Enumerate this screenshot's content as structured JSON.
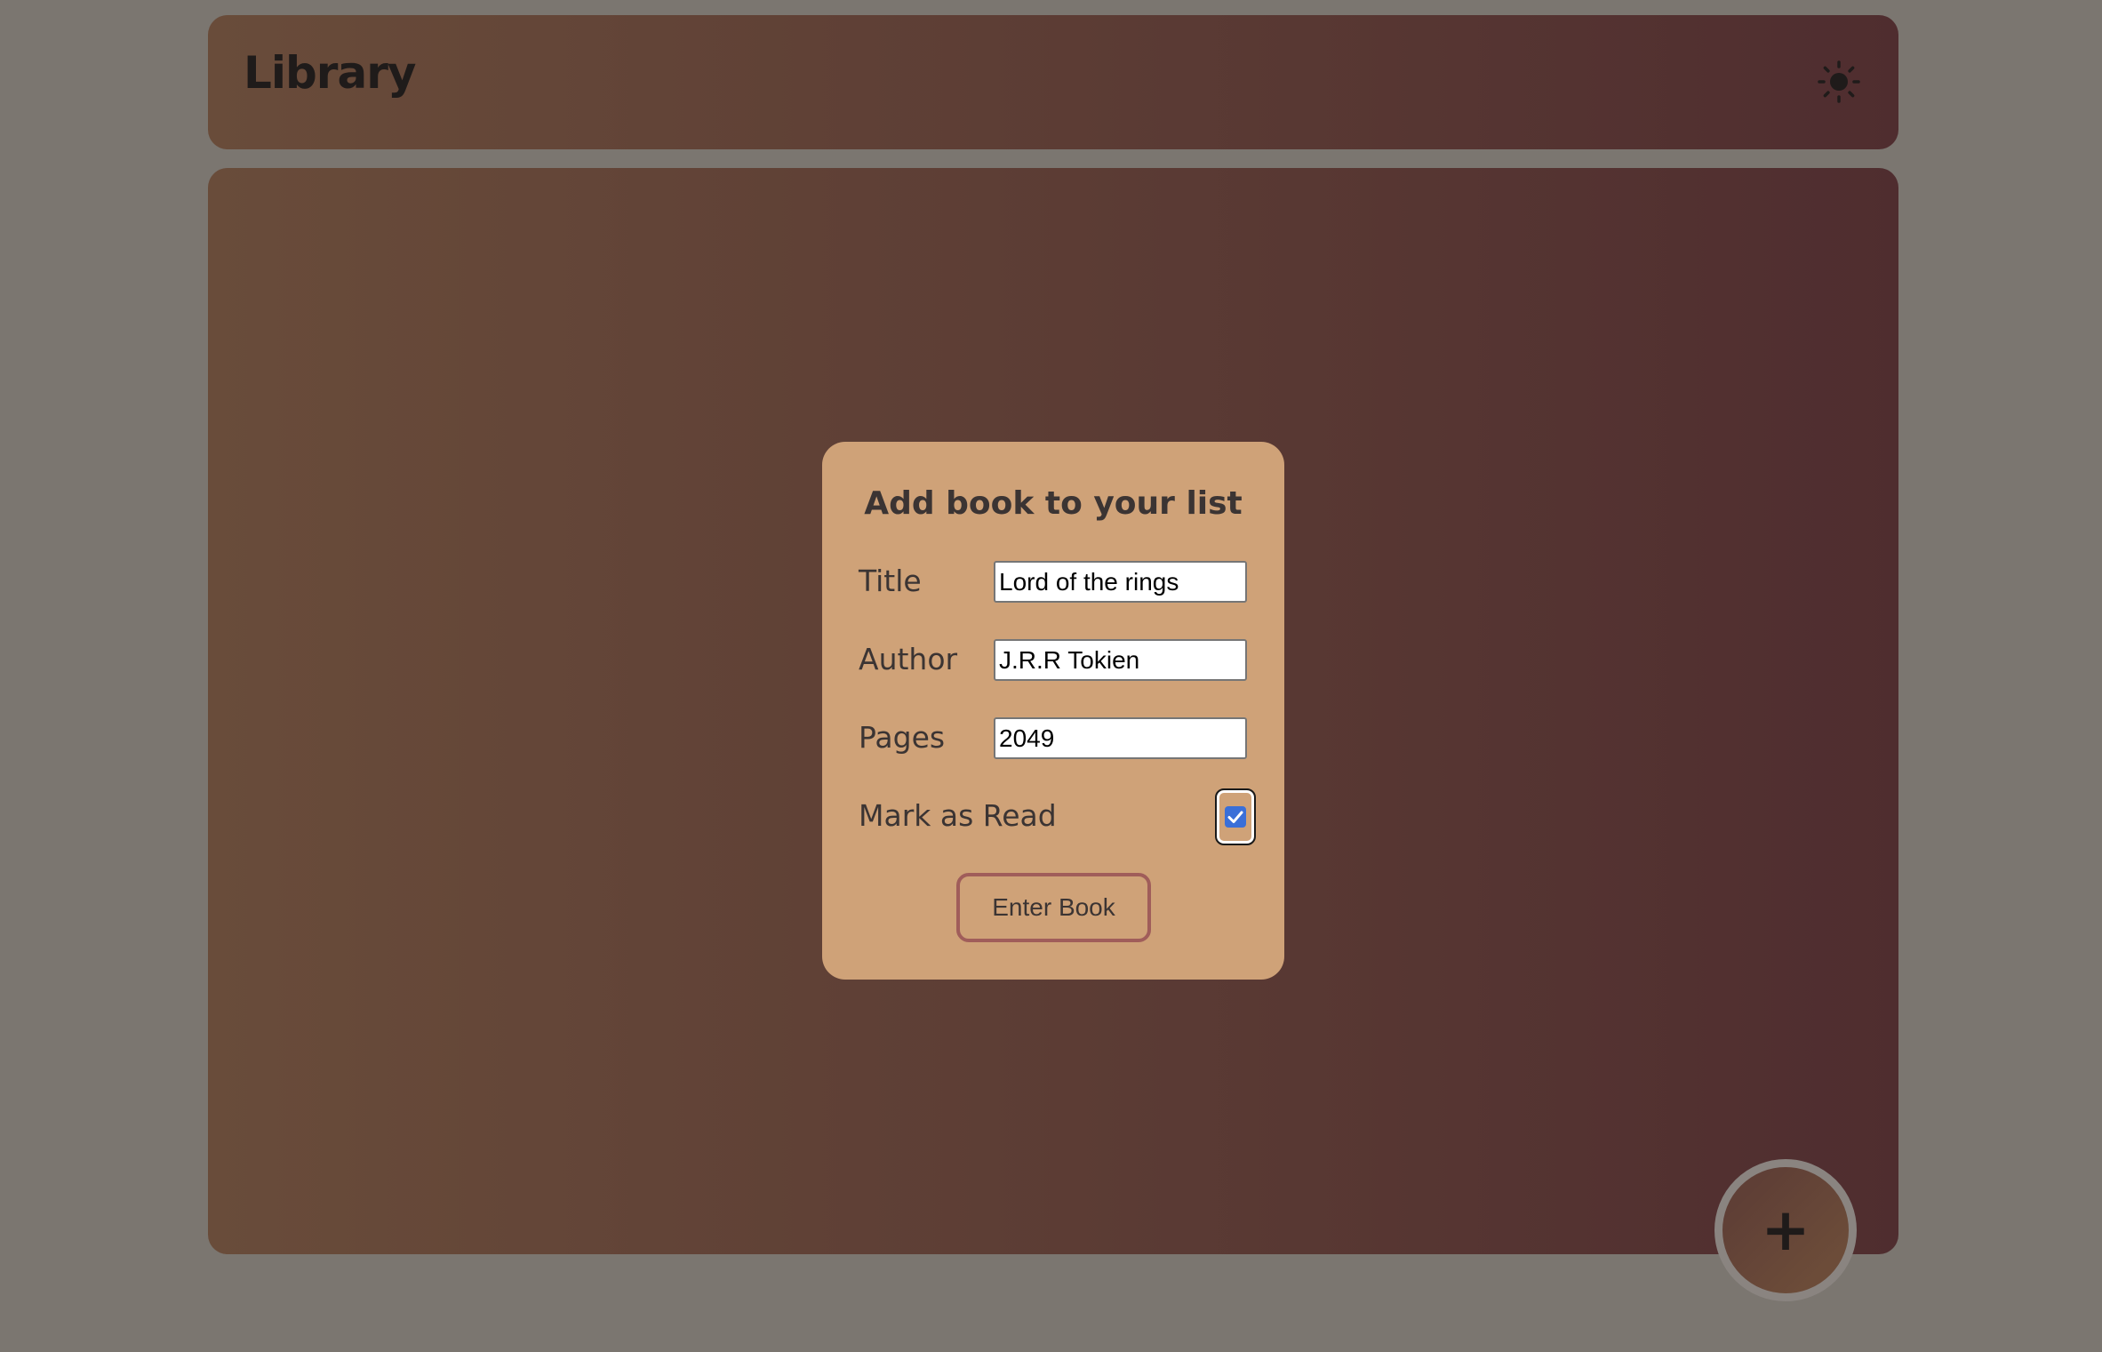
{
  "header": {
    "title": "Library",
    "theme_toggle_icon": "sun-icon"
  },
  "modal": {
    "title": "Add book to your list",
    "fields": {
      "title": {
        "label": "Title",
        "value": "Lord of the rings"
      },
      "author": {
        "label": "Author",
        "value": "J.R.R Tokien"
      },
      "pages": {
        "label": "Pages",
        "value": "2049"
      }
    },
    "read": {
      "label": "Mark as Read",
      "checked": true
    },
    "submit_label": "Enter Book"
  },
  "fab": {
    "label": "+",
    "icon": "plus-icon"
  },
  "colors": {
    "page_background": "#7b7670",
    "panel_gradient_start": "#694c3a",
    "panel_gradient_end": "#4f2d2f",
    "modal_background": "#cfa278",
    "text_dark": "#3b3433",
    "button_border": "#a05d5a",
    "checkbox_accent": "#3a6fd8"
  }
}
